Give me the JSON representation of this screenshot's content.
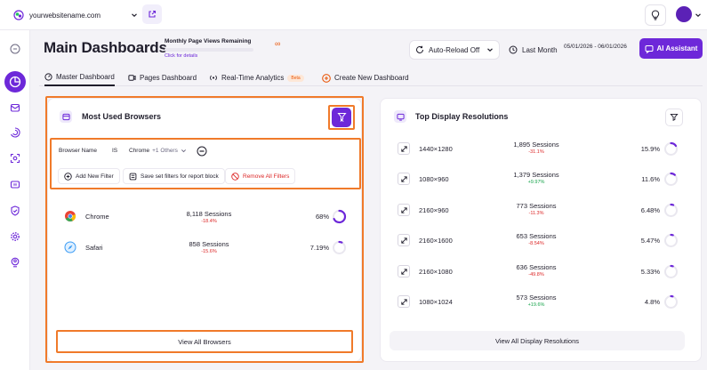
{
  "topbar": {
    "site": "yourwebsitename.com"
  },
  "header": {
    "title": "Main Dashboards",
    "monthly_views_title": "Monthly Page Views Remaining",
    "monthly_views_link": "Click for details",
    "monthly_views_value": "∞",
    "auto_reload": "Auto-Reload Off",
    "period": "Last Month",
    "date_range": "05/01/2026 - 06/01/2026",
    "ai_assistant": "AI Assistant"
  },
  "tabs": [
    {
      "label": "Master Dashboard"
    },
    {
      "label": "Pages Dashboard"
    },
    {
      "label": "Real-Time Analytics",
      "badge": "Beta"
    },
    {
      "label": "Create New Dashboard"
    }
  ],
  "browsers_card": {
    "title": "Most Used Browsers",
    "filter": {
      "field": "Browser Name",
      "operator": "IS",
      "value": "Chrome",
      "extra": "+1 Others"
    },
    "actions": {
      "add": "Add New Filter",
      "save": "Save set filters for report block",
      "remove": "Remove All Filters"
    },
    "rows": [
      {
        "name": "Chrome",
        "sessions": "8,118 Sessions",
        "change": "-18.4%",
        "pct": "68%",
        "fill": 0.68
      },
      {
        "name": "Safari",
        "sessions": "858 Sessions",
        "change": "-15.6%",
        "pct": "7.19%",
        "fill": 0.0719
      }
    ],
    "view_all": "View All Browsers"
  },
  "resolutions_card": {
    "title": "Top Display Resolutions",
    "rows": [
      {
        "name": "1440×1280",
        "sessions": "1,895 Sessions",
        "change": "-31.1%",
        "trend": "neg",
        "pct": "15.9%",
        "fill": 0.159
      },
      {
        "name": "1080×960",
        "sessions": "1,379 Sessions",
        "change": "+9.97%",
        "trend": "pos",
        "pct": "11.6%",
        "fill": 0.116
      },
      {
        "name": "2160×960",
        "sessions": "773 Sessions",
        "change": "-11.3%",
        "trend": "neg",
        "pct": "6.48%",
        "fill": 0.0648
      },
      {
        "name": "2160×1600",
        "sessions": "653 Sessions",
        "change": "-8.54%",
        "trend": "neg",
        "pct": "5.47%",
        "fill": 0.0547
      },
      {
        "name": "2160×1080",
        "sessions": "636 Sessions",
        "change": "-49.8%",
        "trend": "neg",
        "pct": "5.33%",
        "fill": 0.0533
      },
      {
        "name": "1080×1024",
        "sessions": "573 Sessions",
        "change": "+19.6%",
        "trend": "pos",
        "pct": "4.8%",
        "fill": 0.048
      }
    ],
    "view_all": "View All Display Resolutions"
  },
  "colors": {
    "accent": "#6d28d9",
    "highlight": "#f07a2a",
    "negative": "#dc2626",
    "positive": "#16a34a"
  }
}
